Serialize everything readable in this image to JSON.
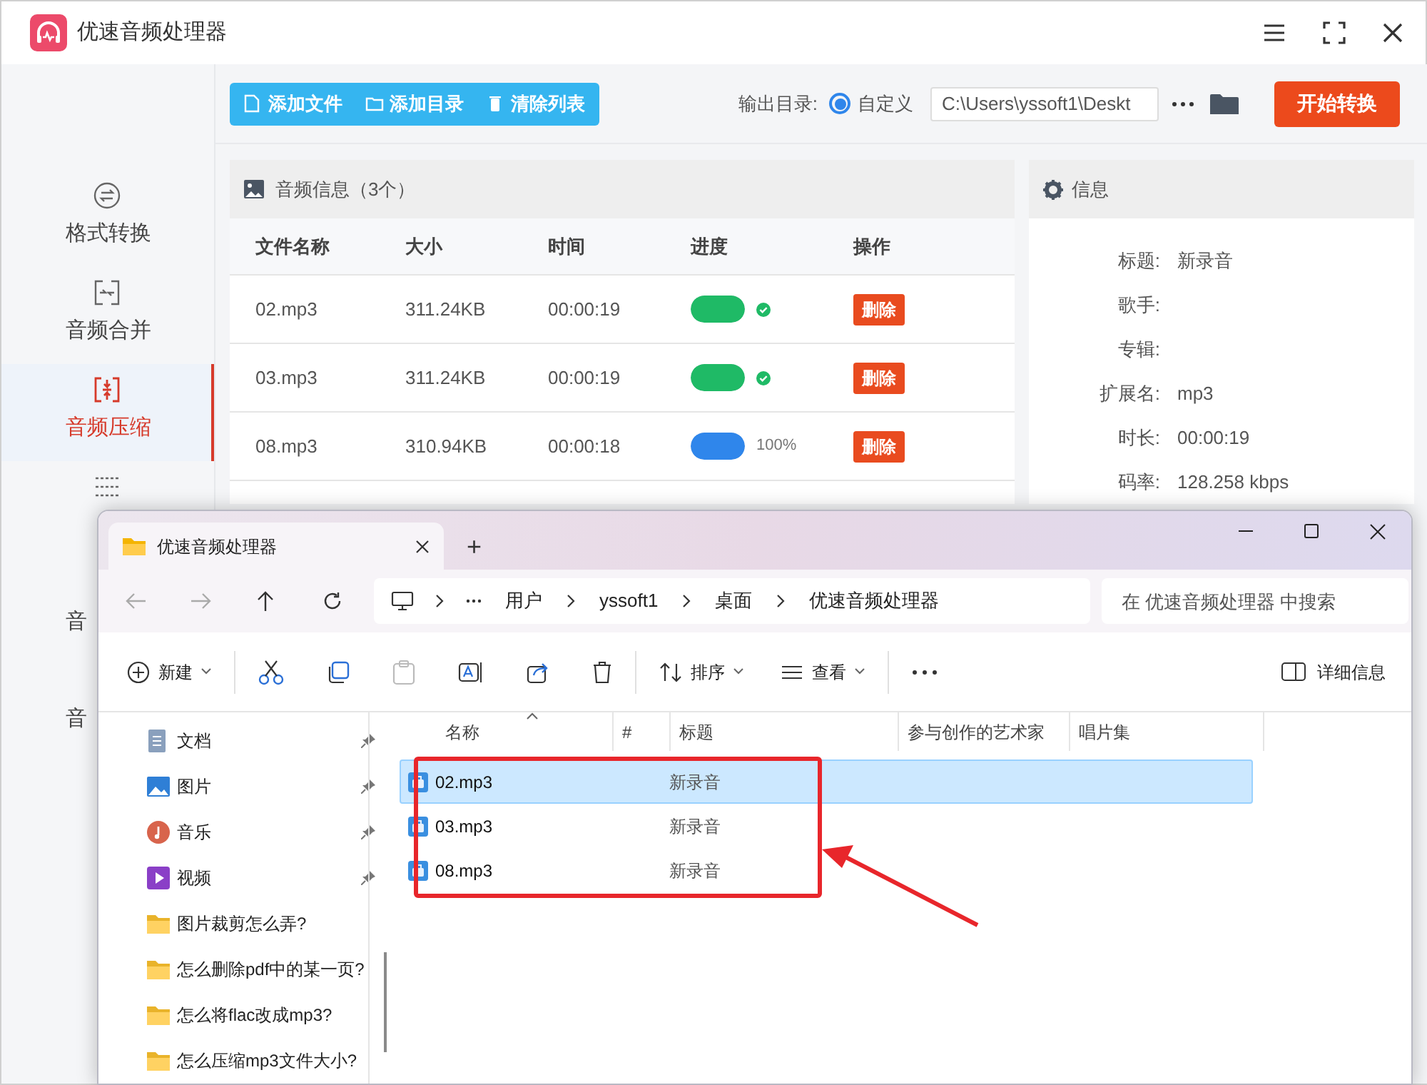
{
  "window": {
    "title": "优速音频处理器"
  },
  "sidebar": {
    "items": [
      {
        "label": "格式转换",
        "selected": false
      },
      {
        "label": "音频合并",
        "selected": false
      },
      {
        "label": "音频压缩",
        "selected": true
      },
      {
        "selected": false
      },
      {
        "label": "音",
        "selected": false
      },
      {
        "label": "音",
        "selected": false
      }
    ]
  },
  "toolbar": {
    "buttons": [
      {
        "label": "添加文件"
      },
      {
        "label": "添加目录"
      },
      {
        "label": "清除列表"
      }
    ],
    "output_label": "输出目录:",
    "output_option": {
      "label": "自定义",
      "selected": true
    },
    "output_path": "C:\\Users\\yssoft1\\Deskt",
    "start_button": "开始转换"
  },
  "file_panel": {
    "title": "音频信息（3个）",
    "columns": [
      "文件名称",
      "大小",
      "时间",
      "进度",
      "操作"
    ],
    "rows": [
      {
        "name": "02.mp3",
        "size": "311.24KB",
        "time": "00:00:19",
        "kind": "done",
        "level": 1,
        "action": "删除"
      },
      {
        "name": "03.mp3",
        "size": "311.24KB",
        "time": "00:00:19",
        "kind": "done",
        "level": 1,
        "action": "删除"
      },
      {
        "name": "08.mp3",
        "size": "310.94KB",
        "time": "00:00:18",
        "kind": "converting",
        "level": 1,
        "reading": "100%",
        "action": "删除"
      }
    ]
  },
  "info_panel": {
    "title": "信息",
    "fields": [
      {
        "label": "标题:",
        "value": "新录音"
      },
      {
        "label": "歌手:"
      },
      {
        "label": "专辑:"
      },
      {
        "label": "扩展名:",
        "value": "mp3"
      },
      {
        "label": "时长:",
        "value": "00:00:19"
      },
      {
        "label": "码率:",
        "value": "128.258 kbps"
      }
    ]
  },
  "explorer": {
    "tab_title": "优速音频处理器",
    "new_tab": "+",
    "breadcrumb": [
      "用户",
      "yssoft1",
      "桌面",
      "优速音频处理器"
    ],
    "search": {
      "placeholder": "在 优速音频处理器 中搜索"
    },
    "commands": [
      {
        "label": "新建",
        "kind": "new"
      },
      {
        "label": "排序",
        "kind": "sort"
      },
      {
        "label": "查看",
        "kind": "view"
      }
    ],
    "details_button": "详细信息",
    "nav_items": [
      {
        "label": "文档",
        "kind": "documents",
        "pinned": true
      },
      {
        "label": "图片",
        "kind": "pictures",
        "pinned": true
      },
      {
        "label": "音乐",
        "kind": "music",
        "pinned": true
      },
      {
        "label": "视频",
        "kind": "videos",
        "pinned": true
      },
      {
        "label": "图片裁剪怎么弄?",
        "kind": "folder",
        "pinned": false
      },
      {
        "label": "怎么删除pdf中的某一页?",
        "kind": "folder",
        "pinned": false
      },
      {
        "label": "怎么将flac改成mp3?",
        "kind": "folder",
        "pinned": false
      },
      {
        "label": "怎么压缩mp3文件大小?",
        "kind": "folder",
        "pinned": false
      }
    ],
    "columns": [
      "名称",
      "#",
      "标题",
      "参与创作的艺术家",
      "唱片集"
    ],
    "files": [
      {
        "name": "02.mp3",
        "title": "新录音",
        "selected": true
      },
      {
        "name": "03.mp3",
        "title": "新录音",
        "selected": false
      },
      {
        "name": "08.mp3",
        "title": "新录音",
        "selected": false
      }
    ]
  }
}
